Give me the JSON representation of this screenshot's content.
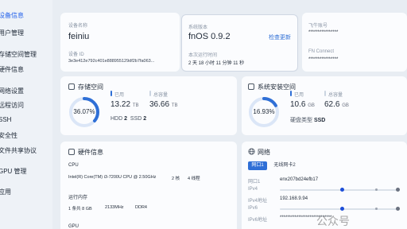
{
  "sidebar": {
    "items": [
      {
        "label": "设备信息",
        "active": true
      },
      {
        "label": "用户管理"
      },
      {
        "label": "存储空间管理"
      },
      {
        "label": "硬件信息"
      },
      {
        "label": "网络设置"
      },
      {
        "label": "远程访问"
      },
      {
        "label": "SSH"
      },
      {
        "label": "安全性"
      },
      {
        "label": "文件共享协议"
      },
      {
        "label": "GPU 管理"
      },
      {
        "label": "应用"
      }
    ]
  },
  "device": {
    "name_label": "设备名称",
    "name": "feiniu",
    "id_label": "设备 ID",
    "id": "3e3e412e792c401e888955129df2b7fa063..."
  },
  "system": {
    "version_label": "系统版本",
    "version": "fnOS  0.9.2",
    "update_link": "检查更新",
    "uptime_label": "本次运行时间",
    "uptime": "2 天 18 小时 11 分钟 11 秒"
  },
  "account": {
    "feiniu_label": "飞牛账号",
    "feiniu_value": "****************",
    "fn_connect_label": "FN Connect",
    "fn_connect_value": "****************"
  },
  "storage": {
    "title": "存储空间",
    "percent": "36.07%",
    "percent_value": 0.3607,
    "used_label": "已用",
    "used_value": "13.22",
    "used_unit": "TB",
    "total_label": "总容量",
    "total_value": "36.66",
    "total_unit": "TB",
    "hdd_label": "HDD",
    "hdd_count": "2",
    "ssd_label": "SSD",
    "ssd_count": "2"
  },
  "sys_space": {
    "title": "系统安装空间",
    "percent": "16.93%",
    "percent_value": 0.1693,
    "used_label": "已用",
    "used_value": "10.6",
    "used_unit": "GB",
    "total_label": "总容量",
    "total_value": "62.6",
    "total_unit": "GB",
    "disk_type_label": "硬盘类型",
    "disk_type": "SSD"
  },
  "hardware": {
    "title": "硬件信息",
    "cpu_label": "CPU",
    "cpu_model": "Intel(R) Core(TM) i3-7200U CPU @ 2.50GHz",
    "cpu_cores": "2 核",
    "cpu_threads": "4 线程",
    "mem_label": "运行内存",
    "mem_size": "1 条共 8 GB",
    "mem_freq": "2133MHz",
    "mem_type": "DDR4",
    "gpu_label": "GPU"
  },
  "network": {
    "title": "网络",
    "tabs": [
      {
        "label": "网口1",
        "active": true
      },
      {
        "label": "无线网卡2"
      }
    ],
    "rows": [
      {
        "label": "网口1",
        "value": "enx207bd24efb17"
      },
      {
        "label": "IPv4",
        "value": ""
      },
      {
        "label": "IPv4地址",
        "value": "192.168.9.94"
      },
      {
        "label": "IPv6",
        "value": ""
      },
      {
        "label": "IPv6地址",
        "value": "****************************"
      }
    ]
  },
  "watermark": "公众号",
  "colors": {
    "accent": "#2f6fd6",
    "accent_light": "#dbe6f7",
    "active_tab": "#2f6fd6"
  }
}
